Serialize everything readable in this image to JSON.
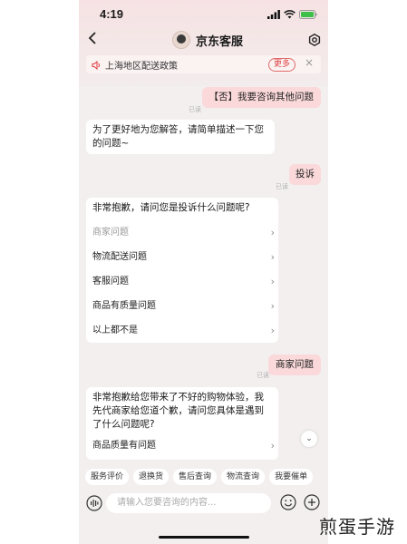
{
  "status_bar": {
    "time": "4:19"
  },
  "header": {
    "title": "京东客服"
  },
  "notice": {
    "text": "上海地区配送政策",
    "more_label": "更多",
    "close": "×"
  },
  "messages": {
    "m1": {
      "text": "【否】我要咨询其他问题",
      "read": "已读"
    },
    "m2": {
      "line1": "为了更好地为您解答，请简单描述一下您",
      "line2": "的问题~"
    },
    "m3": {
      "text": "投诉",
      "read": "已读"
    },
    "m4": {
      "question": "非常抱歉，请问您是投诉什么问题呢?",
      "options": [
        "商家问题",
        "物流配送问题",
        "客服问题",
        "商品有质量问题",
        "以上都不是"
      ]
    },
    "m5": {
      "text": "商家问题",
      "read": "已读"
    },
    "m6": {
      "line1": "非常抱歉给您带来了不好的购物体验，我",
      "line2": "先代商家给您道个歉，请问您具体是遇到",
      "line3": "了什么问题呢?",
      "option": "商品质量有问题"
    }
  },
  "quick_chips": [
    "服务评价",
    "退换货",
    "售后查询",
    "物流查询",
    "我要催单"
  ],
  "input": {
    "placeholder": "请输入您要咨询的内容..."
  },
  "watermark": "煎蛋手游",
  "colors": {
    "accent": "#e0393e",
    "right_bubble": "#fbd9da",
    "background": "#f3efef"
  }
}
